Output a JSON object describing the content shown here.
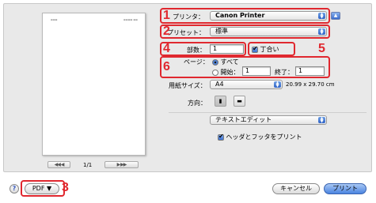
{
  "printer": {
    "label": "プリンタ：",
    "value": "Canon Printer"
  },
  "preset": {
    "label": "プリセット：",
    "value": "標準"
  },
  "copies": {
    "label": "部数：",
    "value": "1",
    "collate_label": "丁合い"
  },
  "pages": {
    "label": "ページ：",
    "all_label": "すべて",
    "from_label": "開始：",
    "from_value": "1",
    "to_label": "終了：",
    "to_value": "1"
  },
  "paper_size": {
    "label": "用紙サイズ：",
    "value": "A4",
    "dimensions": "20.99 x 29.70 cm"
  },
  "orientation": {
    "label": "方向："
  },
  "app_panel": {
    "value": "テキストエディット"
  },
  "header_footer": {
    "label": "ヘッダとフッタをプリント"
  },
  "preview": {
    "page_indicator": "1/1",
    "nav_first_prev": "◀◀  ◀",
    "nav_next_last": "▶  ▶▶"
  },
  "footer": {
    "help": "?",
    "pdf_label": "PDF ▼",
    "cancel_label": "キャンセル",
    "print_label": "プリント"
  },
  "annotations": [
    "1",
    "2",
    "3",
    "4",
    "5",
    "6"
  ],
  "colors": {
    "annotation": "#e0282f",
    "accent": "#3b6ccd"
  }
}
